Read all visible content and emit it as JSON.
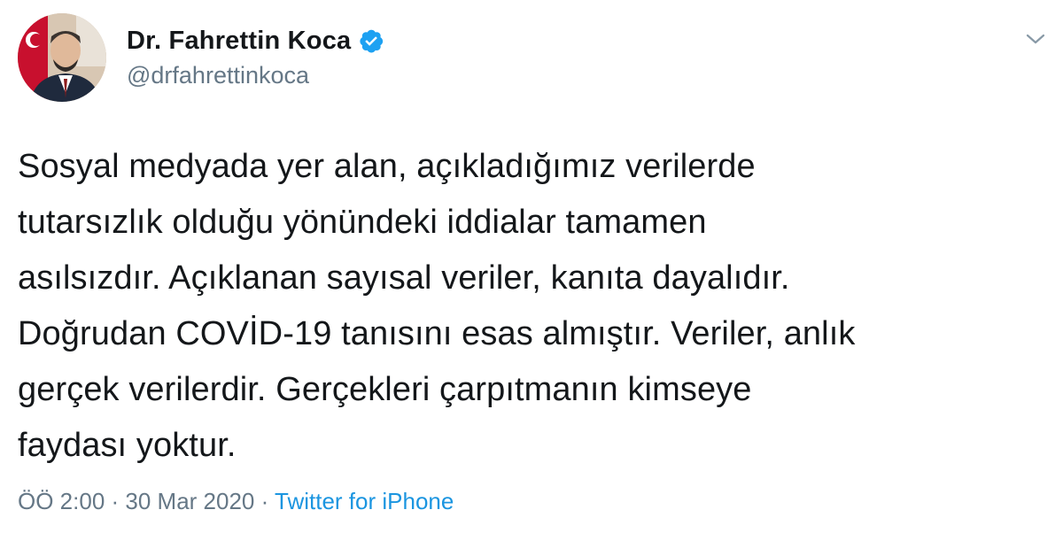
{
  "author": {
    "display_name": "Dr. Fahrettin Koca",
    "handle": "@drfahrettinkoca",
    "verified": true
  },
  "icons": {
    "verified": "verified-badge-icon",
    "menu": "chevron-down-icon",
    "avatar": "profile-photo"
  },
  "tweet": {
    "lines": [
      "Sosyal medyada yer alan, açıkladığımız verilerde",
      "tutarsızlık olduğu yönündeki iddialar tamamen",
      "asılsızdır. Açıklanan sayısal veriler, kanıta dayalıdır.",
      "Doğrudan COVİD-19 tanısını esas almıştır. Veriler, anlık",
      "gerçek verilerdir. Gerçekleri çarpıtmanın kimseye",
      "faydası yoktur."
    ]
  },
  "meta": {
    "time": "ÖÖ 2:00",
    "separator": " · ",
    "date": "30 Mar 2020",
    "source": "Twitter for iPhone"
  },
  "colors": {
    "text": "#14171a",
    "secondary": "#657786",
    "link": "#1b95e0",
    "verified": "#1da1f2"
  }
}
